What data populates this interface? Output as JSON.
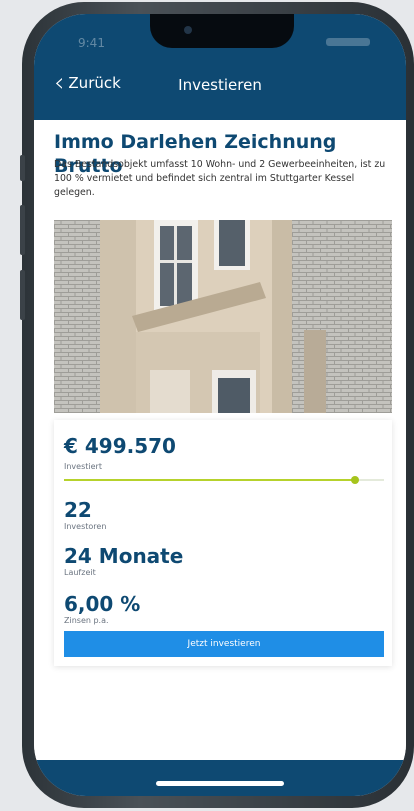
{
  "status_bar": {
    "time": "9:41"
  },
  "nav": {
    "back_label": "Zurück",
    "title": "Investieren"
  },
  "project": {
    "title": "Immo Darlehen Zeichnung Brutto",
    "description": "Das Bestandsobjekt umfasst 10 Wohn- und 2 Gewerbeeinheiten, ist zu 100 % vermietet und befindet sich zentral im Stuttgarter Kessel gelegen."
  },
  "stats": {
    "invested": {
      "value": "€ 499.570",
      "label": "Investiert",
      "progress": 0.91
    },
    "investors": {
      "value": "22",
      "label": "Investoren"
    },
    "duration": {
      "value": "24 Monate",
      "label": "Laufzeit"
    },
    "interest": {
      "value": "6,00 %",
      "label": "Zinsen p.a."
    }
  },
  "cta": {
    "label": "Jetzt investieren"
  },
  "colors": {
    "brand": "#0e4972",
    "button": "#1f8ee6",
    "progress": "#b6d22c"
  }
}
